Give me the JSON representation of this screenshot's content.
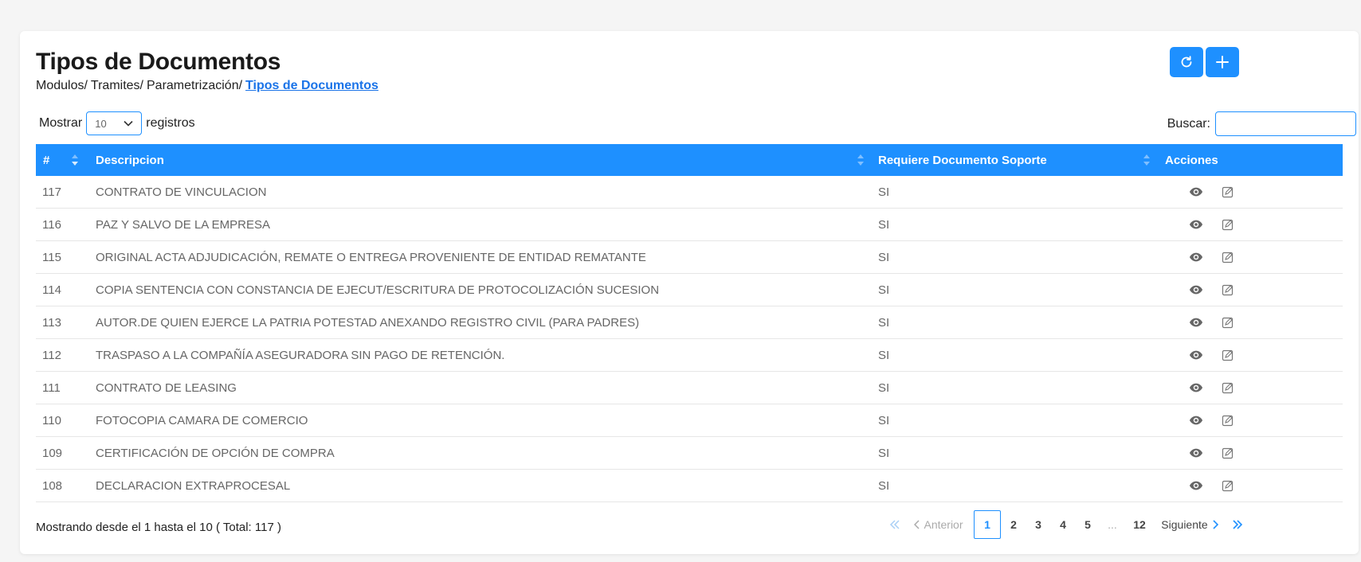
{
  "page": {
    "title": "Tipos de Documentos",
    "breadcrumb": [
      "Modulos/",
      "Tramites/",
      "Parametrización/"
    ],
    "breadcrumb_current": "Tipos de Documentos"
  },
  "controls": {
    "show_label": "Mostrar",
    "page_size": "10",
    "records_label": "registros",
    "search_label": "Buscar:",
    "search_value": ""
  },
  "table": {
    "headers": {
      "id": "#",
      "description": "Descripcion",
      "requires": "Requiere Documento Soporte",
      "actions": "Acciones"
    },
    "rows": [
      {
        "id": "117",
        "description": "CONTRATO DE VINCULACION",
        "requires": "SI"
      },
      {
        "id": "116",
        "description": "PAZ Y SALVO DE LA EMPRESA",
        "requires": "SI"
      },
      {
        "id": "115",
        "description": "ORIGINAL ACTA ADJUDICACIÓN, REMATE O ENTREGA PROVENIENTE DE ENTIDAD REMATANTE",
        "requires": "SI"
      },
      {
        "id": "114",
        "description": "COPIA SENTENCIA CON CONSTANCIA DE EJECUT/ESCRITURA DE PROTOCOLIZACIÓN SUCESION",
        "requires": "SI"
      },
      {
        "id": "113",
        "description": "AUTOR.DE QUIEN EJERCE LA PATRIA POTESTAD ANEXANDO REGISTRO CIVIL (PARA PADRES)",
        "requires": "SI"
      },
      {
        "id": "112",
        "description": "TRASPASO A LA COMPAÑÍA ASEGURADORA SIN PAGO DE RETENCIÓN.",
        "requires": "SI"
      },
      {
        "id": "111",
        "description": "CONTRATO DE LEASING",
        "requires": "SI"
      },
      {
        "id": "110",
        "description": "FOTOCOPIA CAMARA DE COMERCIO",
        "requires": "SI"
      },
      {
        "id": "109",
        "description": "CERTIFICACIÓN DE OPCIÓN DE COMPRA",
        "requires": "SI"
      },
      {
        "id": "108",
        "description": "DECLARACION EXTRAPROCESAL",
        "requires": "SI"
      }
    ]
  },
  "footer": {
    "info": "Mostrando desde el 1 hasta el 10 ( Total: 117 )",
    "prev_label": "Anterior",
    "next_label": "Siguiente",
    "pages": [
      "1",
      "2",
      "3",
      "4",
      "5",
      "...",
      "12"
    ],
    "current_page": "1"
  },
  "colors": {
    "accent": "#1e90ff",
    "link": "#1a73e8"
  }
}
